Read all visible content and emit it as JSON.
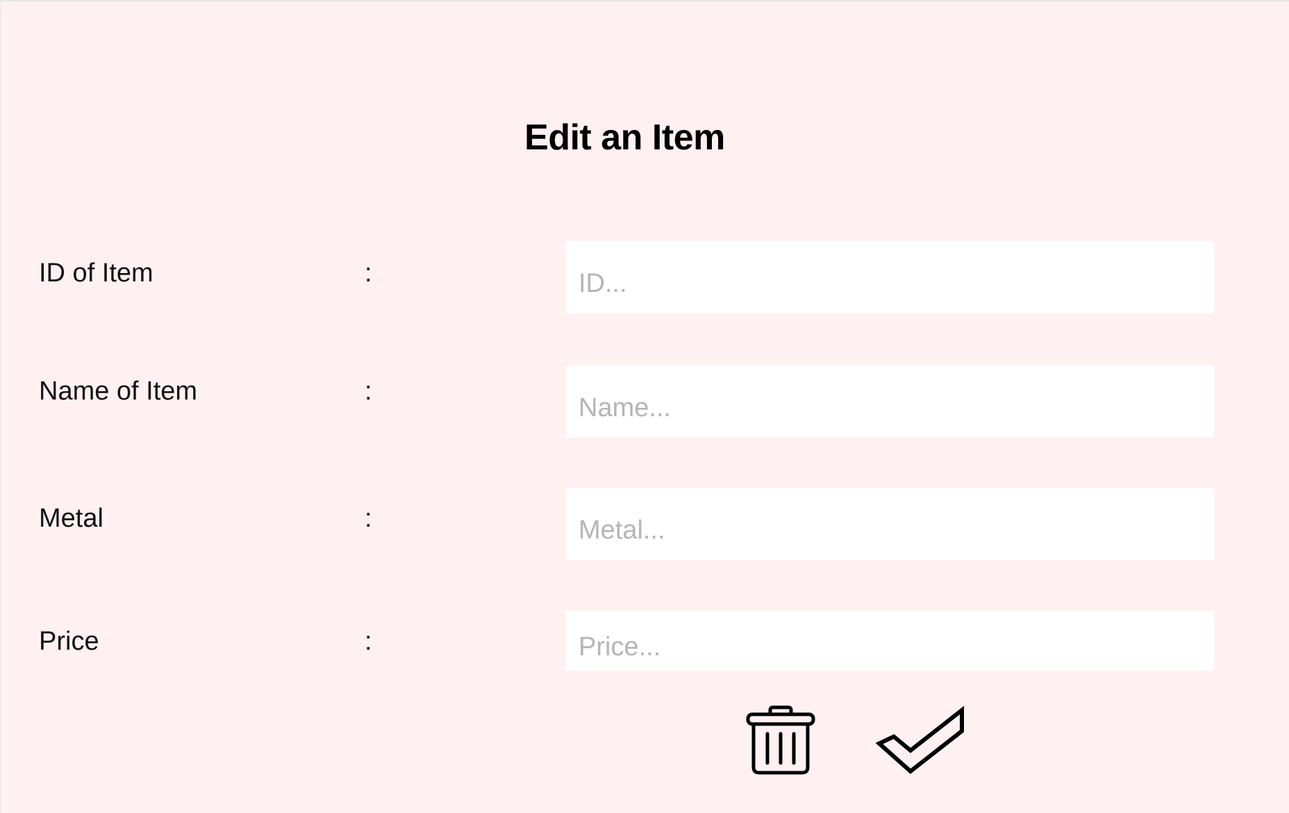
{
  "header": {
    "title": "Edit an Item"
  },
  "form": {
    "colon": ":",
    "fields": [
      {
        "label": "ID of Item",
        "placeholder": "ID...",
        "value": ""
      },
      {
        "label": "Name of Item",
        "placeholder": "Name...",
        "value": ""
      },
      {
        "label": "Metal",
        "placeholder": "Metal...",
        "value": ""
      },
      {
        "label": "Price",
        "placeholder": "Price...",
        "value": ""
      }
    ]
  },
  "actions": {
    "delete_icon": "trash-icon",
    "confirm_icon": "checkmark-icon"
  },
  "colors": {
    "background": "#fff1f1",
    "field_background": "#ffffff",
    "placeholder": "#b5b5b5",
    "text": "#111111"
  }
}
